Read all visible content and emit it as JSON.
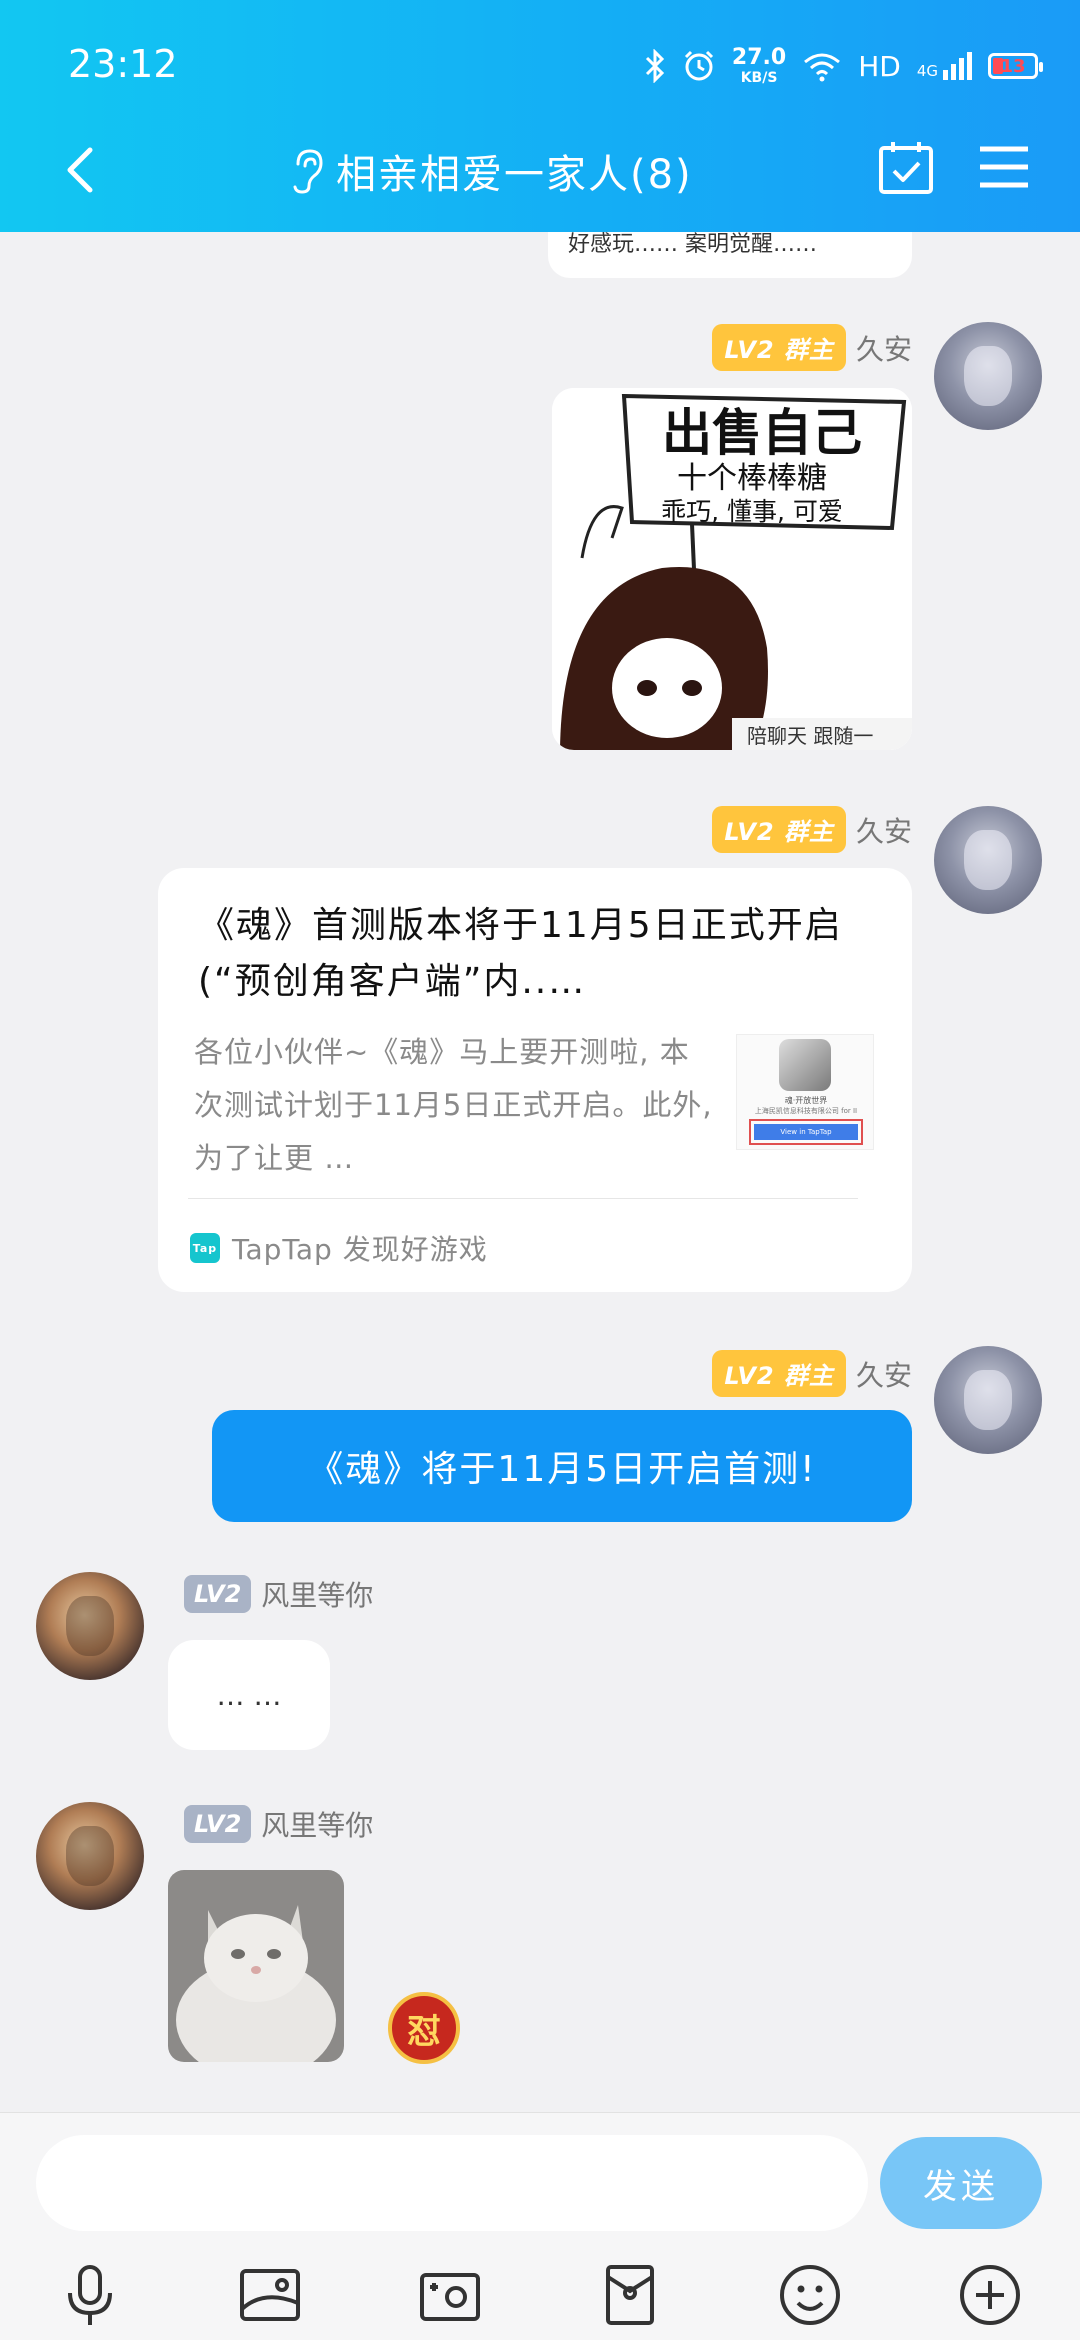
{
  "status_bar": {
    "time": "23:12",
    "net_speed_value": "27.0",
    "net_speed_unit": "KB/S",
    "hd": "HD",
    "network": "4G",
    "battery": "13"
  },
  "header": {
    "title": "相亲相爱一家人(8)"
  },
  "top_partial_text": "好感玩…… 案明觉醒……",
  "messages": [
    {
      "badge": "LV2 群主",
      "sender": "久安",
      "image_caption_main": "出售自己",
      "image_caption_sub": "十个棒棒糖",
      "image_caption_sub2": "乖巧, 懂事, 可爱",
      "image_caption_bottom": "陪聊天 跟随一"
    },
    {
      "badge": "LV2 群主",
      "sender": "久安",
      "card": {
        "title": "《魂》首测版本将于11月5日正式开启(“预创角客户端”内..…",
        "desc": "各位小伙伴~《魂》马上要开测啦, 本次测试计划于11月5日正式开启。此外, 为了让更 …",
        "thumb_line1": "魂·开放世界",
        "thumb_line2": "上海民凯信息科技有限公司 for II",
        "thumb_button": "View in TapTap",
        "source": "TapTap 发现好游戏",
        "source_logo": "Tap"
      }
    },
    {
      "badge": "LV2 群主",
      "sender": "久安",
      "text": "《魂》将于11月5日开启首测!"
    },
    {
      "badge": "LV2",
      "sender": "风里等你",
      "text": "… …"
    },
    {
      "badge": "LV2",
      "sender": "风里等你",
      "reaction": "怼"
    }
  ],
  "input_bar": {
    "send_label": "发送"
  },
  "colors": {
    "header_start": "#12c7f2",
    "header_end": "#1a9bf7",
    "owner_badge": "#ffc53d",
    "blue_bubble": "#1296f5",
    "send_button": "#78c6f7"
  }
}
